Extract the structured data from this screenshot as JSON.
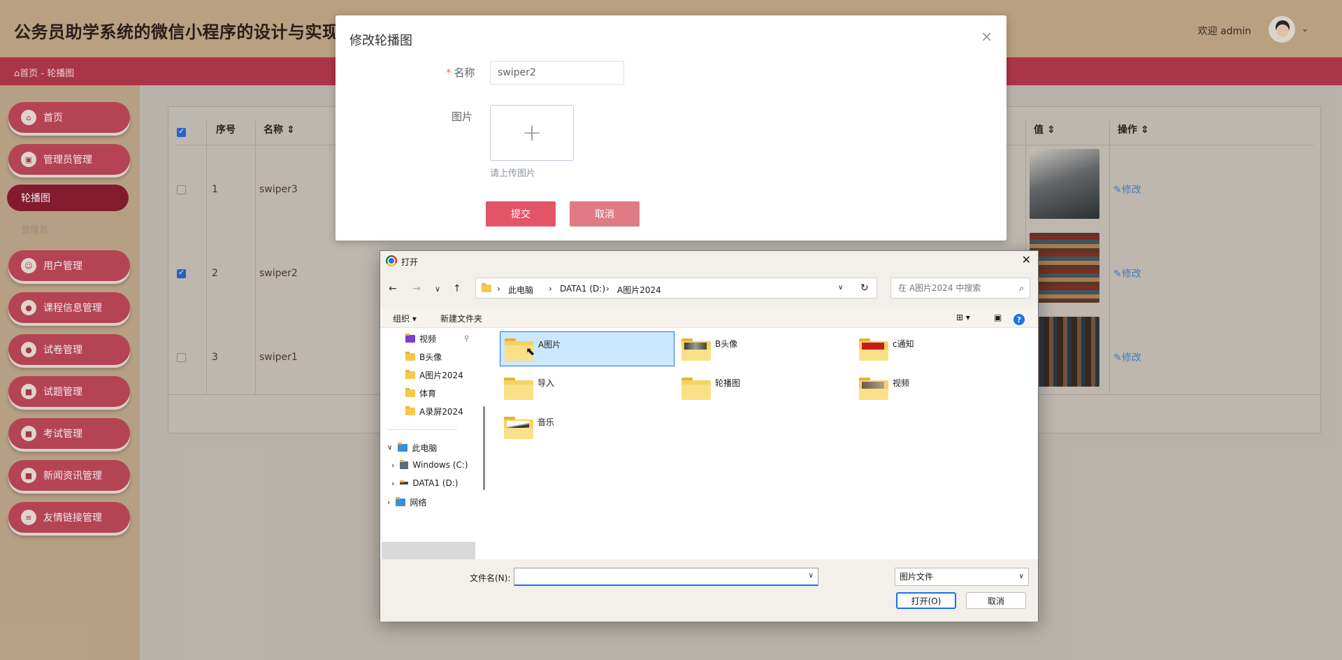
{
  "app": {
    "title": "公务员助学系统的微信小程序的设计与实现",
    "welcome": "欢迎 admin",
    "breadcrumb": {
      "home": "首页",
      "sep": "-",
      "current": "轮播图"
    }
  },
  "sidebar": {
    "items": [
      {
        "label": "首页",
        "icon": "home-icon"
      },
      {
        "label": "管理员管理",
        "icon": "admin-icon"
      },
      {
        "label": "轮播图",
        "active": true
      },
      {
        "label": "用户管理",
        "icon": "user-icon"
      },
      {
        "label": "课程信息管理",
        "icon": "course-icon"
      },
      {
        "label": "试卷管理",
        "icon": "paper-icon"
      },
      {
        "label": "试题管理",
        "icon": "question-icon"
      },
      {
        "label": "考试管理",
        "icon": "exam-icon"
      },
      {
        "label": "新闻资讯管理",
        "icon": "news-icon"
      },
      {
        "label": "友情链接管理",
        "icon": "link-icon"
      }
    ],
    "sub_item": "管理员"
  },
  "table": {
    "headers": {
      "index": "序号",
      "name": "名称",
      "value": "值",
      "action": "操作"
    },
    "rows": [
      {
        "index": "1",
        "name": "swiper3",
        "checked": false,
        "action": "修改"
      },
      {
        "index": "2",
        "name": "swiper2",
        "checked": true,
        "action": "修改"
      },
      {
        "index": "3",
        "name": "swiper1",
        "checked": false,
        "action": "修改"
      }
    ]
  },
  "edit_dialog": {
    "title": "修改轮播图",
    "name_label": "名称",
    "name_value": "swiper2",
    "image_label": "图片",
    "upload_tip": "请上传图片",
    "submit": "提交",
    "cancel": "取消"
  },
  "file_dialog": {
    "title": "打开",
    "path": [
      "此电脑",
      "DATA1 (D:)",
      "A图片2024"
    ],
    "search_placeholder": "在 A图片2024 中搜索",
    "toolbar": {
      "organize": "组织 ▾",
      "new_folder": "新建文件夹"
    },
    "tree": [
      {
        "label": "视频",
        "pinned": true
      },
      {
        "label": "B头像"
      },
      {
        "label": "A图片2024"
      },
      {
        "label": "体育"
      },
      {
        "label": "A录屏2024"
      },
      {
        "label": "此电脑"
      },
      {
        "label": "Windows (C:)"
      },
      {
        "label": "DATA1 (D:)"
      },
      {
        "label": "网络"
      }
    ],
    "items": [
      {
        "name": "A图片",
        "selected": true
      },
      {
        "name": "B头像"
      },
      {
        "name": "c通知"
      },
      {
        "name": "导入"
      },
      {
        "name": "轮播图"
      },
      {
        "name": "视频"
      },
      {
        "name": "音乐"
      }
    ],
    "filename_label": "文件名(N):",
    "filename_value": "",
    "filetype": "图片文件",
    "open_button": "打开(O)",
    "cancel_button": "取消"
  },
  "colors": {
    "accent": "#e45468",
    "crumb_bar": "#b93a4c",
    "top_bar": "#c9ae8c",
    "windows_blue": "#1a73e8"
  }
}
